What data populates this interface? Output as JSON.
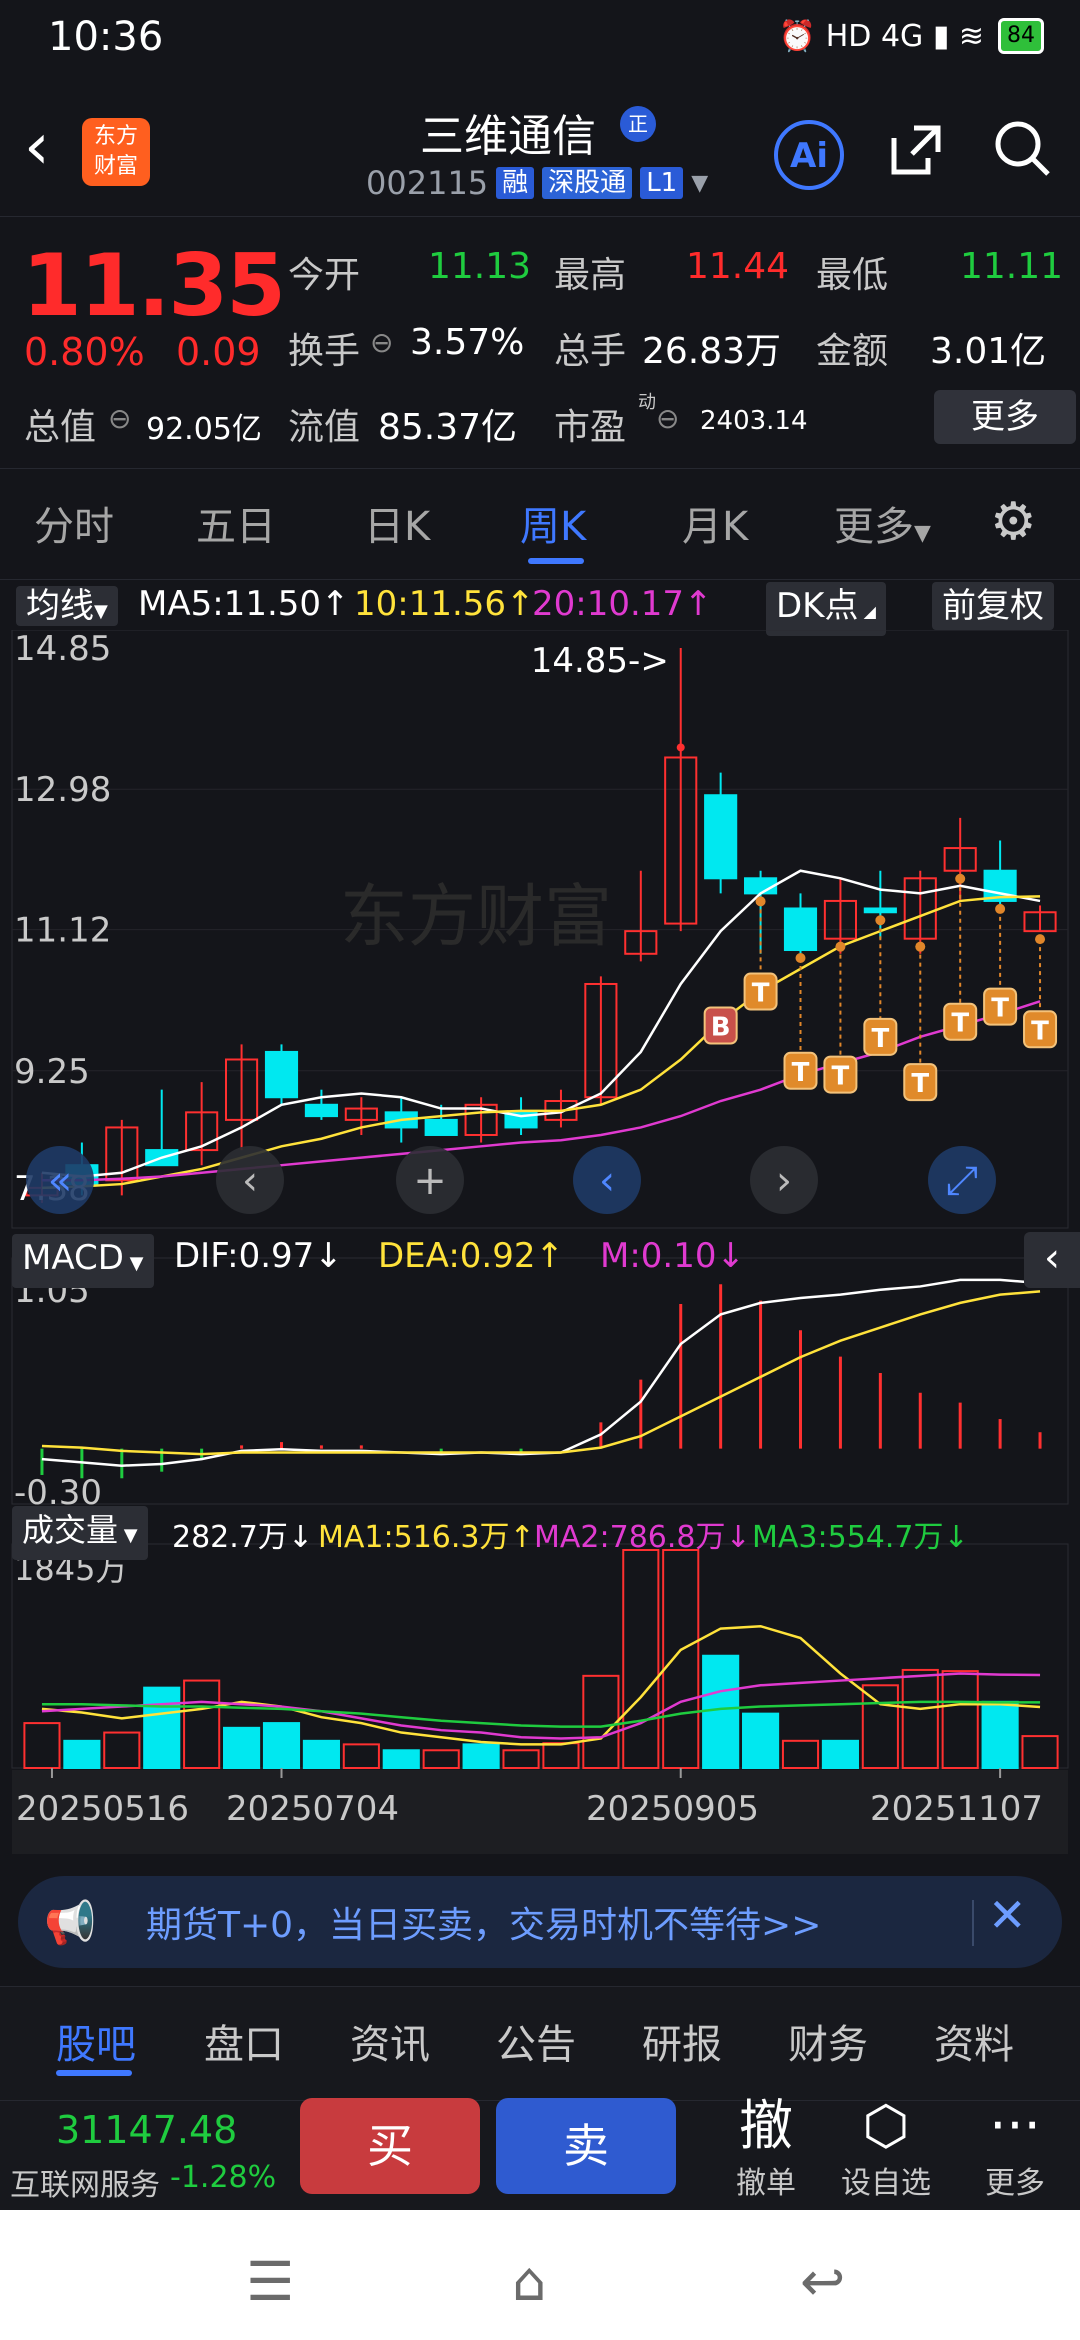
{
  "status": {
    "time": "10:36",
    "icons": "⏰ HD 4G ▮ ≋",
    "battery": "84"
  },
  "header": {
    "back_icon": "‹",
    "logo": "东方\n财富",
    "title": "三维通信",
    "badge": "正",
    "code": "002115",
    "tag1": "融",
    "tag2": "深股通",
    "tag3": "L1"
  },
  "quote": {
    "price": "11.35",
    "chg_pct": "0.80%",
    "chg_abs": "0.09",
    "row1": [
      {
        "label": "今开",
        "val": "11.13",
        "color": "green"
      },
      {
        "label": "最高",
        "val": "11.44",
        "color": "red"
      },
      {
        "label": "最低",
        "val": "11.11",
        "color": "green"
      }
    ],
    "row2": [
      {
        "label": "换手",
        "val": "3.57%",
        "color": "white"
      },
      {
        "label": "总手",
        "val": "26.83万",
        "color": "white"
      },
      {
        "label": "金额",
        "val": "3.01亿",
        "color": "white"
      }
    ],
    "row3": [
      {
        "label": "总值",
        "val": "92.05亿",
        "color": "white"
      },
      {
        "label": "流值",
        "val": "85.37亿",
        "color": "white"
      },
      {
        "label": "市盈",
        "val": "2403.14",
        "color": "white"
      }
    ],
    "pe_super": "动",
    "more": "更多"
  },
  "tabs": [
    "分时",
    "五日",
    "日K",
    "周K",
    "月K",
    "更多"
  ],
  "toolbar": {
    "ma_btn": "均线",
    "ma5": "MA5:11.50↑",
    "ma10": "10:11.56↑",
    "ma20": "20:10.17↑",
    "dk": "DK点",
    "fq": "前复权"
  },
  "kline": {
    "y_labels": [
      "14.85",
      "12.98",
      "11.12",
      "9.25"
    ],
    "high_label": "14.85->",
    "low_label": "7.38",
    "watermark": "东方财富",
    "ylim": [
      7.38,
      14.85
    ],
    "candles": [
      {
        "o": 7.6,
        "h": 7.9,
        "l": 7.5,
        "c": 7.7
      },
      {
        "o": 8.0,
        "h": 8.3,
        "l": 7.6,
        "c": 7.75
      },
      {
        "o": 7.8,
        "h": 8.6,
        "l": 7.6,
        "c": 8.5
      },
      {
        "o": 8.2,
        "h": 9.0,
        "l": 8.0,
        "c": 8.0
      },
      {
        "o": 8.2,
        "h": 9.1,
        "l": 8.0,
        "c": 8.7
      },
      {
        "o": 8.6,
        "h": 9.6,
        "l": 8.2,
        "c": 9.4
      },
      {
        "o": 9.5,
        "h": 9.6,
        "l": 8.8,
        "c": 8.9
      },
      {
        "o": 8.8,
        "h": 9.0,
        "l": 8.6,
        "c": 8.65
      },
      {
        "o": 8.6,
        "h": 8.9,
        "l": 8.4,
        "c": 8.75
      },
      {
        "o": 8.7,
        "h": 8.9,
        "l": 8.3,
        "c": 8.5
      },
      {
        "o": 8.6,
        "h": 8.8,
        "l": 8.4,
        "c": 8.4
      },
      {
        "o": 8.4,
        "h": 8.9,
        "l": 8.3,
        "c": 8.8
      },
      {
        "o": 8.7,
        "h": 8.9,
        "l": 8.4,
        "c": 8.5
      },
      {
        "o": 8.6,
        "h": 9.0,
        "l": 8.5,
        "c": 8.85
      },
      {
        "o": 8.9,
        "h": 10.5,
        "l": 8.8,
        "c": 10.4
      },
      {
        "o": 10.8,
        "h": 11.9,
        "l": 10.7,
        "c": 11.1
      },
      {
        "o": 11.2,
        "h": 14.85,
        "l": 11.1,
        "c": 13.4
      },
      {
        "o": 12.9,
        "h": 13.2,
        "l": 11.6,
        "c": 11.8
      },
      {
        "o": 11.8,
        "h": 11.9,
        "l": 10.8,
        "c": 11.6
      },
      {
        "o": 11.4,
        "h": 11.6,
        "l": 10.8,
        "c": 10.85
      },
      {
        "o": 11.0,
        "h": 11.8,
        "l": 10.8,
        "c": 11.5
      },
      {
        "o": 11.4,
        "h": 11.9,
        "l": 11.0,
        "c": 11.35
      },
      {
        "o": 11.0,
        "h": 11.9,
        "l": 10.8,
        "c": 11.8
      },
      {
        "o": 11.9,
        "h": 12.6,
        "l": 11.5,
        "c": 12.2
      },
      {
        "o": 11.9,
        "h": 12.3,
        "l": 11.4,
        "c": 11.5
      },
      {
        "o": 11.1,
        "h": 11.44,
        "l": 11.11,
        "c": 11.35
      }
    ],
    "ma5": [
      7.9,
      7.85,
      7.9,
      8.1,
      8.25,
      8.5,
      8.8,
      8.9,
      8.95,
      8.9,
      8.75,
      8.75,
      8.65,
      8.7,
      8.95,
      9.5,
      10.4,
      11.1,
      11.6,
      11.9,
      11.8,
      11.65,
      11.6,
      11.7,
      11.6,
      11.5
    ],
    "ma10": [
      7.7,
      7.72,
      7.75,
      7.85,
      7.95,
      8.1,
      8.25,
      8.35,
      8.5,
      8.6,
      8.65,
      8.7,
      8.72,
      8.72,
      8.8,
      9.0,
      9.4,
      9.9,
      10.3,
      10.6,
      10.9,
      11.1,
      11.3,
      11.5,
      11.55,
      11.56
    ],
    "ma20": [
      7.8,
      7.8,
      7.82,
      7.85,
      7.9,
      7.95,
      8.0,
      8.05,
      8.1,
      8.15,
      8.2,
      8.25,
      8.3,
      8.33,
      8.4,
      8.5,
      8.65,
      8.85,
      9.0,
      9.2,
      9.35,
      9.5,
      9.7,
      9.85,
      10.0,
      10.17
    ],
    "signals": [
      {
        "i": 17,
        "t": "B",
        "v": 9.85
      },
      {
        "i": 18,
        "t": "T",
        "v": 10.3
      },
      {
        "i": 19,
        "t": "T",
        "v": 9.25
      },
      {
        "i": 20,
        "t": "T",
        "v": 9.2
      },
      {
        "i": 21,
        "t": "T",
        "v": 9.7
      },
      {
        "i": 22,
        "t": "T",
        "v": 9.1
      },
      {
        "i": 23,
        "t": "T",
        "v": 9.9
      },
      {
        "i": 24,
        "t": "T",
        "v": 10.1
      },
      {
        "i": 25,
        "t": "T",
        "v": 9.8
      }
    ]
  },
  "macd_bar": {
    "label": "MACD",
    "dif": "DIF:0.97↓",
    "dea": "DEA:0.92↑",
    "m": "M:0.10↓",
    "y_top": "1.05",
    "y_bot": "-0.30"
  },
  "macd": {
    "dif": [
      -0.1,
      -0.12,
      -0.14,
      -0.13,
      -0.1,
      -0.05,
      -0.04,
      -0.05,
      -0.05,
      -0.06,
      -0.07,
      -0.06,
      -0.07,
      -0.06,
      0.05,
      0.25,
      0.6,
      0.78,
      0.85,
      0.88,
      0.9,
      0.93,
      0.95,
      0.99,
      0.99,
      0.97
    ],
    "dea": [
      -0.02,
      -0.03,
      -0.05,
      -0.06,
      -0.07,
      -0.06,
      -0.06,
      -0.06,
      -0.06,
      -0.06,
      -0.06,
      -0.06,
      -0.06,
      -0.06,
      -0.03,
      0.04,
      0.16,
      0.28,
      0.4,
      0.52,
      0.62,
      0.7,
      0.78,
      0.85,
      0.9,
      0.92
    ],
    "m": [
      -0.16,
      -0.18,
      -0.18,
      -0.14,
      -0.06,
      0.02,
      0.04,
      0.02,
      0.02,
      0.0,
      -0.02,
      0.0,
      -0.02,
      0.0,
      0.16,
      0.42,
      0.88,
      1.0,
      0.9,
      0.72,
      0.56,
      0.46,
      0.34,
      0.28,
      0.18,
      0.1
    ]
  },
  "vol_bar": {
    "label": "成交量",
    "vol": "282.7万↓",
    "ma1": "MA1:516.3万↑",
    "ma2": "MA2:786.8万↓",
    "ma3": "MA3:554.7万↓",
    "y_top": "1845万"
  },
  "volume": {
    "vals": [
      380,
      230,
      300,
      680,
      740,
      340,
      380,
      230,
      200,
      150,
      150,
      200,
      150,
      210,
      780,
      1845,
      1845,
      950,
      460,
      230,
      230,
      700,
      830,
      820,
      560,
      270
    ],
    "up": [
      true,
      false,
      true,
      false,
      true,
      false,
      false,
      false,
      true,
      false,
      true,
      false,
      true,
      true,
      true,
      true,
      true,
      false,
      false,
      true,
      false,
      true,
      true,
      true,
      false,
      true
    ],
    "ma1": [
      500,
      470,
      420,
      460,
      500,
      560,
      520,
      430,
      380,
      300,
      260,
      220,
      200,
      200,
      250,
      600,
      1000,
      1180,
      1200,
      1100,
      800,
      540,
      500,
      540,
      540,
      516
    ],
    "ma2": [
      480,
      500,
      520,
      540,
      560,
      540,
      520,
      480,
      420,
      360,
      320,
      300,
      260,
      250,
      260,
      380,
      560,
      650,
      700,
      720,
      740,
      760,
      780,
      800,
      790,
      787
    ],
    "ma3": [
      540,
      540,
      530,
      520,
      520,
      510,
      500,
      480,
      460,
      430,
      400,
      380,
      360,
      350,
      350,
      400,
      460,
      500,
      520,
      530,
      540,
      550,
      560,
      560,
      555,
      555
    ],
    "dates": [
      "20250516",
      "20250704",
      "20250905",
      "20251107"
    ]
  },
  "banner": {
    "text": "期货T+0，当日买卖，交易时机不等待>>",
    "close": "✕"
  },
  "bottom_tabs": [
    "股吧",
    "盘口",
    "资讯",
    "公告",
    "研报",
    "财务",
    "资料"
  ],
  "actionbar": {
    "index_val": "31147.48",
    "index_name": "互联网服务",
    "index_chg": "-1.28%",
    "buy": "买",
    "sell": "卖",
    "cancel_ic": "撤",
    "cancel": "撤单",
    "fav": "设自选",
    "more": "更多"
  },
  "sysnav": {
    "menu": "☰",
    "home": "⌂",
    "back": "↩"
  }
}
